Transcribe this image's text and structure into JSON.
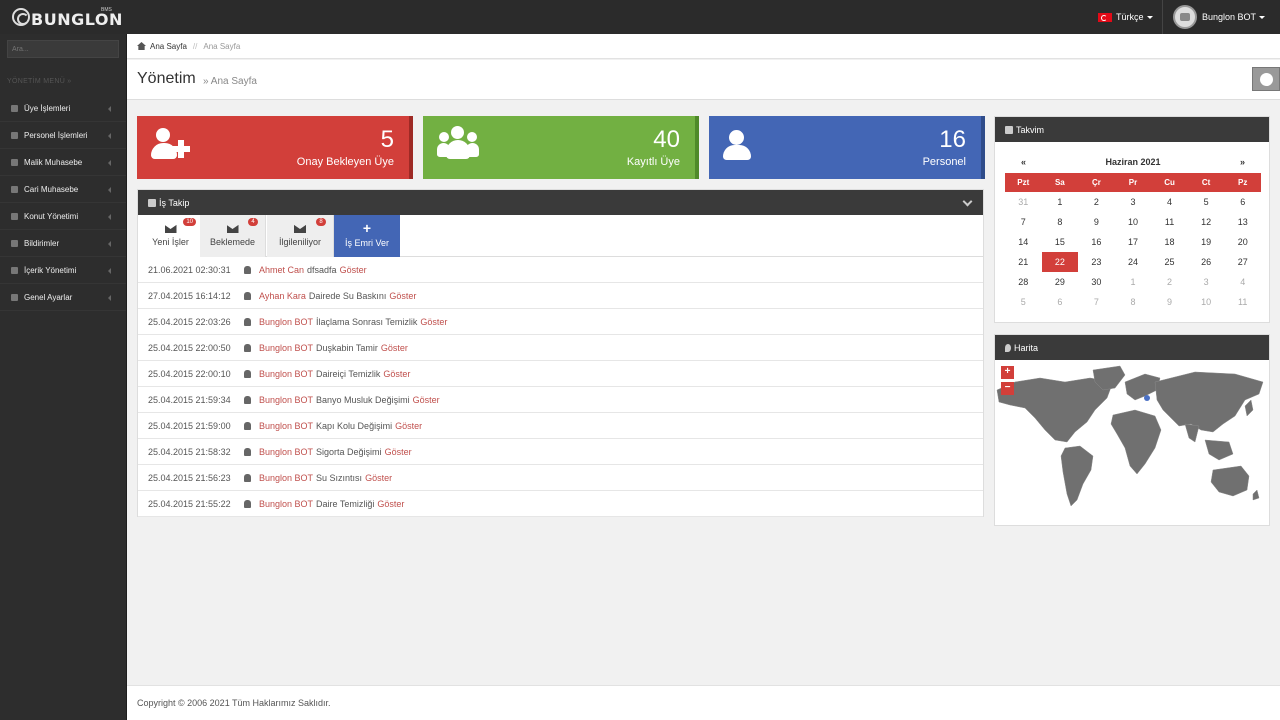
{
  "topbar": {
    "brand": "BUNGLON",
    "brand_suffix": "BMS",
    "language": "Türkçe",
    "user": "Bunglon BOT"
  },
  "sidebar": {
    "search_placeholder": "Ara...",
    "menu_title": "YÖNETİM MENÜ »",
    "items": [
      {
        "label": "Üye İşlemleri"
      },
      {
        "label": "Personel İşlemleri"
      },
      {
        "label": "Malik Muhasebe"
      },
      {
        "label": "Cari Muhasebe"
      },
      {
        "label": "Konut Yönetimi"
      },
      {
        "label": "Bildirimler"
      },
      {
        "label": "İçerik Yönetimi"
      },
      {
        "label": "Genel Ayarlar"
      }
    ]
  },
  "breadcrumb": {
    "home": "Ana Sayfa",
    "separator": "//",
    "current": "Ana Sayfa"
  },
  "page": {
    "title": "Yönetim",
    "subtitle": "» Ana Sayfa"
  },
  "stats": [
    {
      "value": "5",
      "label": "Onay Bekleyen Üye",
      "color": "#d23f3a",
      "icon": "user-plus-icon"
    },
    {
      "value": "40",
      "label": "Kayıtlı Üye",
      "color": "#72b042",
      "icon": "users-icon"
    },
    {
      "value": "16",
      "label": "Personel",
      "color": "#4366b5",
      "icon": "user-icon"
    }
  ],
  "istakip": {
    "title": "İş Takip",
    "tabs": [
      {
        "label": "Yeni İşler",
        "badge": "10"
      },
      {
        "label": "Beklemede",
        "badge": "4"
      },
      {
        "label": "İlgileniliyor",
        "badge": "8"
      },
      {
        "label": "İş Emri Ver"
      }
    ],
    "show_label": "Göster",
    "rows": [
      {
        "date": "21.06.2021 02:30:31",
        "who": "Ahmet Can",
        "what": "dfsadfa"
      },
      {
        "date": "27.04.2015 16:14:12",
        "who": "Ayhan Kara",
        "what": "Dairede Su Baskını"
      },
      {
        "date": "25.04.2015 22:03:26",
        "who": "Bunglon BOT",
        "what": "İlaçlama Sonrası Temizlik"
      },
      {
        "date": "25.04.2015 22:00:50",
        "who": "Bunglon BOT",
        "what": "Duşkabin Tamir"
      },
      {
        "date": "25.04.2015 22:00:10",
        "who": "Bunglon BOT",
        "what": "Daireiçi Temizlik"
      },
      {
        "date": "25.04.2015 21:59:34",
        "who": "Bunglon BOT",
        "what": "Banyo Musluk Değişimi"
      },
      {
        "date": "25.04.2015 21:59:00",
        "who": "Bunglon BOT",
        "what": "Kapı Kolu Değişimi"
      },
      {
        "date": "25.04.2015 21:58:32",
        "who": "Bunglon BOT",
        "what": "Sigorta Değişimi"
      },
      {
        "date": "25.04.2015 21:56:23",
        "who": "Bunglon BOT",
        "what": "Su Sızıntısı"
      },
      {
        "date": "25.04.2015 21:55:22",
        "who": "Bunglon BOT",
        "what": "Daire Temizliği"
      }
    ]
  },
  "takvim": {
    "title": "Takvim",
    "prev": "«",
    "next": "»",
    "month": "Haziran 2021",
    "weekdays": [
      "Pzt",
      "Sa",
      "Çr",
      "Pr",
      "Cu",
      "Ct",
      "Pz"
    ],
    "days": [
      {
        "d": "31",
        "old": true
      },
      {
        "d": "1"
      },
      {
        "d": "2"
      },
      {
        "d": "3"
      },
      {
        "d": "4"
      },
      {
        "d": "5"
      },
      {
        "d": "6"
      },
      {
        "d": "7"
      },
      {
        "d": "8"
      },
      {
        "d": "9"
      },
      {
        "d": "10"
      },
      {
        "d": "11"
      },
      {
        "d": "12"
      },
      {
        "d": "13"
      },
      {
        "d": "14"
      },
      {
        "d": "15"
      },
      {
        "d": "16"
      },
      {
        "d": "17"
      },
      {
        "d": "18"
      },
      {
        "d": "19"
      },
      {
        "d": "20"
      },
      {
        "d": "21"
      },
      {
        "d": "22",
        "today": true
      },
      {
        "d": "23"
      },
      {
        "d": "24"
      },
      {
        "d": "25"
      },
      {
        "d": "26"
      },
      {
        "d": "27"
      },
      {
        "d": "28"
      },
      {
        "d": "29"
      },
      {
        "d": "30"
      },
      {
        "d": "1",
        "old": true
      },
      {
        "d": "2",
        "old": true
      },
      {
        "d": "3",
        "old": true
      },
      {
        "d": "4",
        "old": true
      },
      {
        "d": "5",
        "old": true
      },
      {
        "d": "6",
        "old": true
      },
      {
        "d": "7",
        "old": true
      },
      {
        "d": "8",
        "old": true
      },
      {
        "d": "9",
        "old": true
      },
      {
        "d": "10",
        "old": true
      },
      {
        "d": "11",
        "old": true
      }
    ]
  },
  "harita": {
    "title": "Harita",
    "zoom_in": "+",
    "zoom_out": "−"
  },
  "footer": {
    "text": "Copyright © 2006 2021 Tüm Haklarımız Saklıdır."
  }
}
